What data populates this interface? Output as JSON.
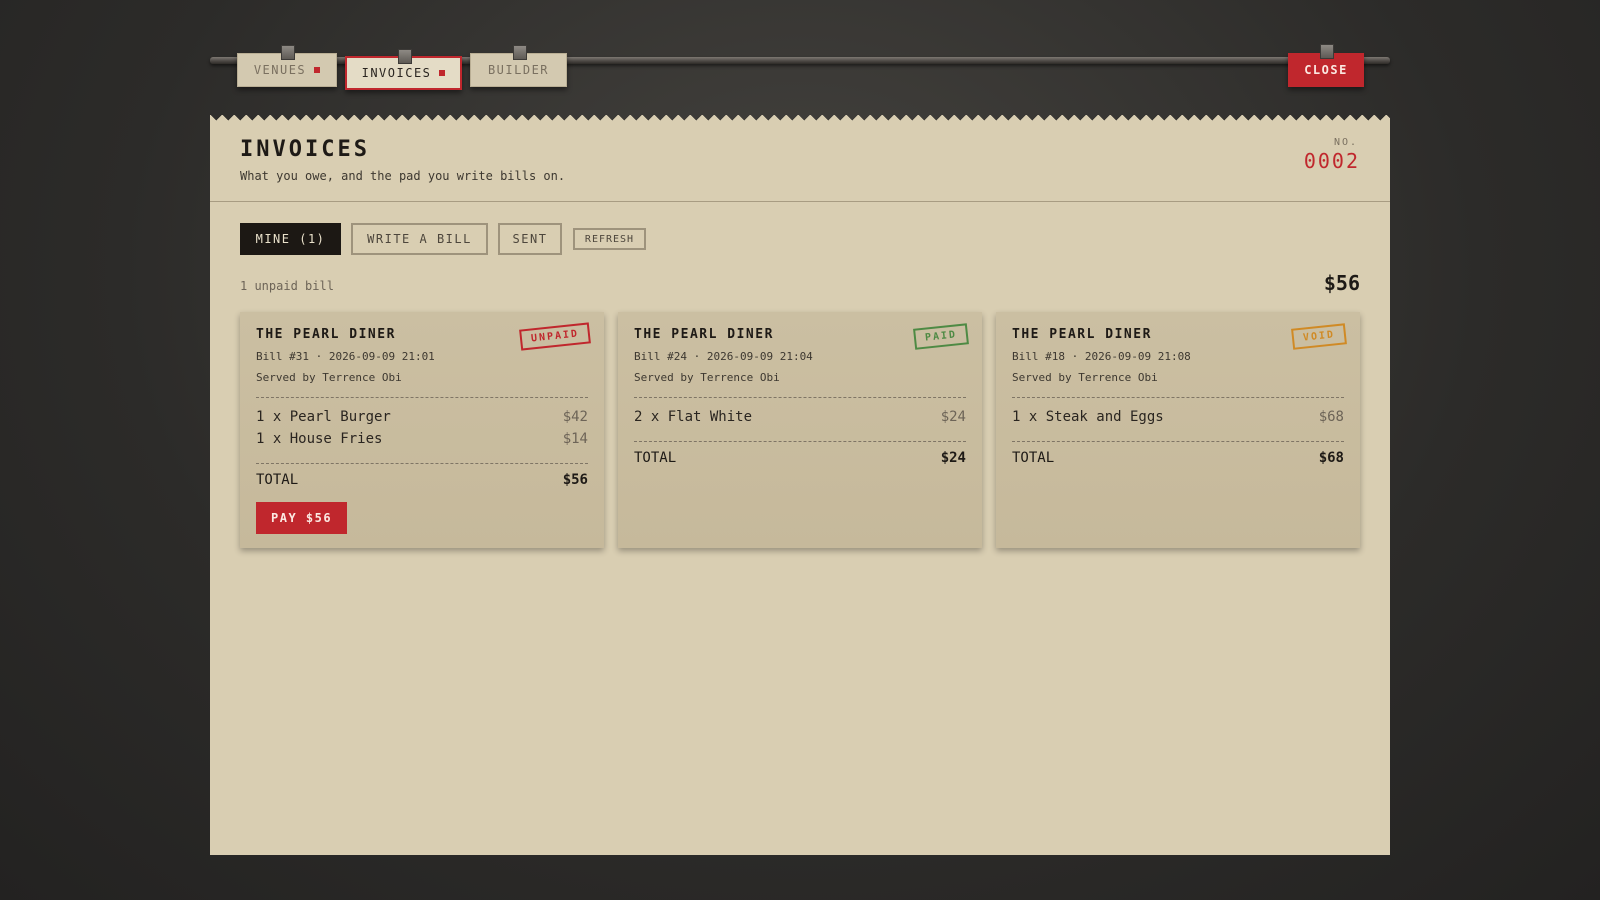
{
  "tabs": [
    {
      "label": "VENUES",
      "dot": true
    },
    {
      "label": "INVOICES",
      "dot": true
    },
    {
      "label": "BUILDER",
      "dot": false
    }
  ],
  "close_label": "CLOSE",
  "header": {
    "title": "INVOICES",
    "subtitle": "What you owe, and the pad you write bills on.",
    "no_label": "NO.",
    "no_value": "0002"
  },
  "filters": {
    "mine": "MINE (1)",
    "write": "WRITE A BILL",
    "sent": "SENT",
    "refresh": "REFRESH"
  },
  "summary": {
    "unpaid_text": "1 unpaid bill",
    "total": "$56"
  },
  "cards": [
    {
      "venue": "THE PEARL DINER",
      "meta": "Bill #31 · 2026-09-09 21:01",
      "served": "Served by Terrence Obi",
      "status": "UNPAID",
      "items": [
        {
          "desc": "1 x Pearl Burger",
          "price": "$42"
        },
        {
          "desc": "1 x House Fries",
          "price": "$14"
        }
      ],
      "total_label": "TOTAL",
      "total": "$56",
      "pay_label": "PAY $56"
    },
    {
      "venue": "THE PEARL DINER",
      "meta": "Bill #24 · 2026-09-09 21:04",
      "served": "Served by Terrence Obi",
      "status": "PAID",
      "items": [
        {
          "desc": "2 x Flat White",
          "price": "$24"
        }
      ],
      "total_label": "TOTAL",
      "total": "$24"
    },
    {
      "venue": "THE PEARL DINER",
      "meta": "Bill #18 · 2026-09-09 21:08",
      "served": "Served by Terrence Obi",
      "status": "VOID",
      "items": [
        {
          "desc": "1 x Steak and Eggs",
          "price": "$68"
        }
      ],
      "total_label": "TOTAL",
      "total": "$68"
    }
  ],
  "colors": {
    "accent": "#c0272d",
    "paper": "#d9ceb2",
    "card": "#c9bd9f",
    "paid": "#4e8a44",
    "void": "#d08a25"
  }
}
